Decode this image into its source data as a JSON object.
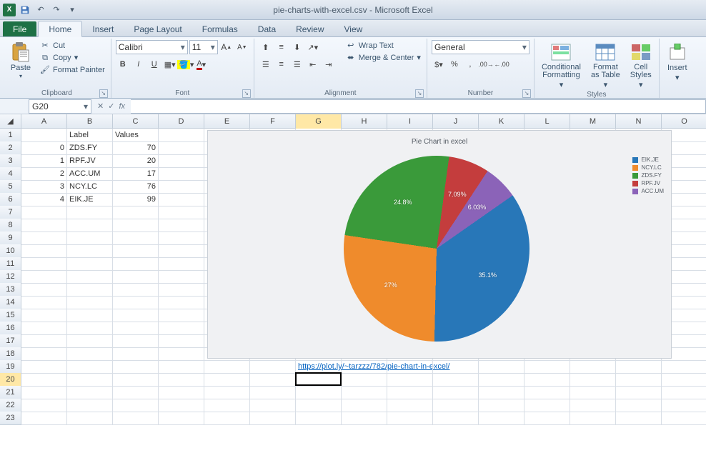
{
  "app": {
    "title": "pie-charts-with-excel.csv - Microsoft Excel",
    "logo_letter": "X"
  },
  "tabs": {
    "file": "File",
    "home": "Home",
    "insert": "Insert",
    "pagelayout": "Page Layout",
    "formulas": "Formulas",
    "data": "Data",
    "review": "Review",
    "view": "View"
  },
  "ribbon": {
    "clipboard": {
      "paste": "Paste",
      "cut": "Cut",
      "copy": "Copy",
      "fmtpainter": "Format Painter",
      "label": "Clipboard"
    },
    "font": {
      "name": "Calibri",
      "size": "11",
      "bold": "B",
      "italic": "I",
      "underline": "U",
      "label": "Font"
    },
    "alignment": {
      "wrap": "Wrap Text",
      "merge": "Merge & Center",
      "label": "Alignment"
    },
    "number": {
      "format": "General",
      "label": "Number"
    },
    "styles": {
      "cond": "Conditional\nFormatting",
      "ftable": "Format\nas Table",
      "cstyles": "Cell\nStyles",
      "label": "Styles"
    },
    "cells": {
      "insert": "Insert",
      "label": ""
    }
  },
  "formula_bar": {
    "namebox": "G20",
    "fx": "fx",
    "value": ""
  },
  "columns": [
    "A",
    "B",
    "C",
    "D",
    "E",
    "F",
    "G",
    "H",
    "I",
    "J",
    "K",
    "L",
    "M",
    "N",
    "O"
  ],
  "selected_col": "G",
  "selected_row": 20,
  "cells": {
    "B1": "Label",
    "C1": "Values",
    "A2": "0",
    "B2": "ZDS.FY",
    "C2": "70",
    "A3": "1",
    "B3": "RPF.JV",
    "C3": "20",
    "A4": "2",
    "B4": "ACC.UM",
    "C4": "17",
    "A5": "3",
    "B5": "NCY.LC",
    "C5": "76",
    "A6": "4",
    "B6": "EIK.JE",
    "C6": "99",
    "G19": "https://plot.ly/~tarzzz/782/pie-chart-in-excel/"
  },
  "chart_data": {
    "type": "pie",
    "title": "Pie Chart in excel",
    "series": [
      {
        "name": "EIK.JE",
        "value": 99,
        "percent": "35.1%",
        "color": "#2877b8"
      },
      {
        "name": "NCY.LC",
        "value": 76,
        "percent": "27%",
        "color": "#ef8b2c"
      },
      {
        "name": "ZDS.FY",
        "value": 70,
        "percent": "24.8%",
        "color": "#3a9a3a"
      },
      {
        "name": "RPF.JV",
        "value": 20,
        "percent": "7.09%",
        "color": "#c43d3d"
      },
      {
        "name": "ACC.UM",
        "value": 17,
        "percent": "6.03%",
        "color": "#8b63b8"
      }
    ],
    "legend_order": [
      "EIK.JE",
      "NCY.LC",
      "ZDS.FY",
      "RPF.JV",
      "ACC.UM"
    ]
  }
}
